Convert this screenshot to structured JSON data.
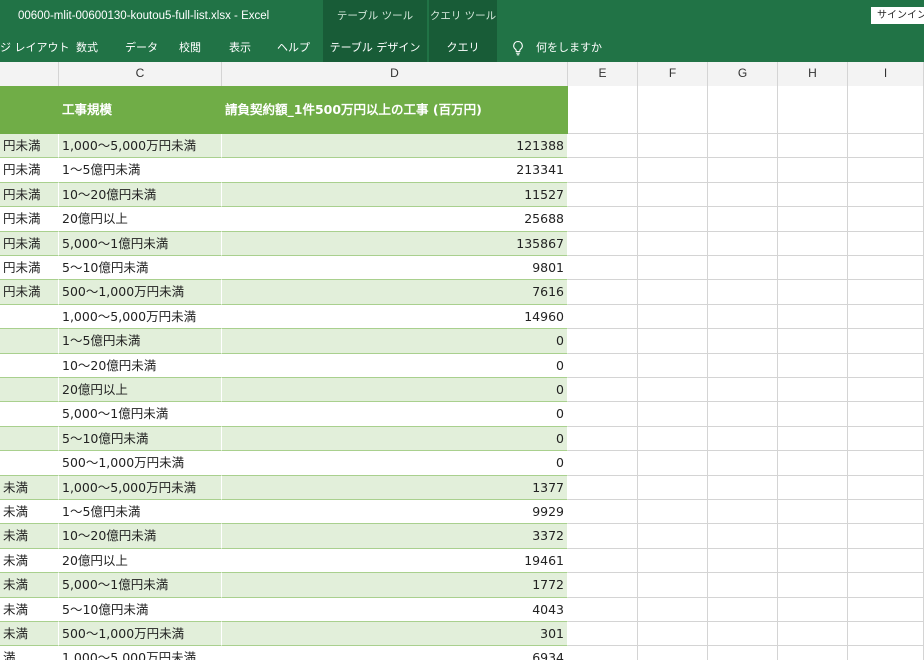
{
  "window": {
    "title": "00600-mlit-00600130-koutou5-full-list.xlsx  -  Excel",
    "ctx_table_tools": "テーブル ツール",
    "ctx_query_tools": "クエリ ツール",
    "signin": "サインイン"
  },
  "ribbon": {
    "tabs": [
      "ジ レイアウト",
      "数式",
      "データ",
      "校閲",
      "表示",
      "ヘルプ"
    ],
    "ctx_tabs": [
      "テーブル デザイン",
      "クエリ"
    ],
    "tell_me": "何をしますか"
  },
  "columns": [
    "C",
    "D",
    "E",
    "F",
    "G",
    "H",
    "I"
  ],
  "table": {
    "headers": {
      "B": "",
      "C": "工事規模",
      "D": "請負契約額_1件500万円以上の工事 (百万円)"
    },
    "rows": [
      {
        "b": "円未満",
        "c": "1,000～5,000万円未満",
        "d": "121388"
      },
      {
        "b": "円未満",
        "c": "1～5億円未満",
        "d": "213341"
      },
      {
        "b": "円未満",
        "c": "10～20億円未満",
        "d": "11527"
      },
      {
        "b": "円未満",
        "c": "20億円以上",
        "d": "25688"
      },
      {
        "b": "円未満",
        "c": "5,000～1億円未満",
        "d": "135867"
      },
      {
        "b": "円未満",
        "c": "5～10億円未満",
        "d": "9801"
      },
      {
        "b": "円未満",
        "c": "500～1,000万円未満",
        "d": "7616"
      },
      {
        "b": "",
        "c": "1,000～5,000万円未満",
        "d": "14960"
      },
      {
        "b": "",
        "c": "1～5億円未満",
        "d": "0"
      },
      {
        "b": "",
        "c": "10～20億円未満",
        "d": "0"
      },
      {
        "b": "",
        "c": "20億円以上",
        "d": "0"
      },
      {
        "b": "",
        "c": "5,000～1億円未満",
        "d": "0"
      },
      {
        "b": "",
        "c": "5～10億円未満",
        "d": "0"
      },
      {
        "b": "",
        "c": "500～1,000万円未満",
        "d": "0"
      },
      {
        "b": "未満",
        "c": "1,000～5,000万円未満",
        "d": "1377"
      },
      {
        "b": "未満",
        "c": "1～5億円未満",
        "d": "9929"
      },
      {
        "b": "未満",
        "c": "10～20億円未満",
        "d": "3372"
      },
      {
        "b": "未満",
        "c": "20億円以上",
        "d": "19461"
      },
      {
        "b": "未満",
        "c": "5,000～1億円未満",
        "d": "1772"
      },
      {
        "b": "未満",
        "c": "5～10億円未満",
        "d": "4043"
      },
      {
        "b": "未満",
        "c": "500～1,000万円未満",
        "d": "301"
      },
      {
        "b": "満",
        "c": "1,000～5,000万円未満",
        "d": "6934"
      }
    ]
  },
  "colors": {
    "title_bar": "#217346",
    "context_tab": "#185c37",
    "table_header": "#70ad47",
    "table_band": "#e2efda"
  },
  "icons": {
    "tell_me": "lightbulb-icon"
  }
}
